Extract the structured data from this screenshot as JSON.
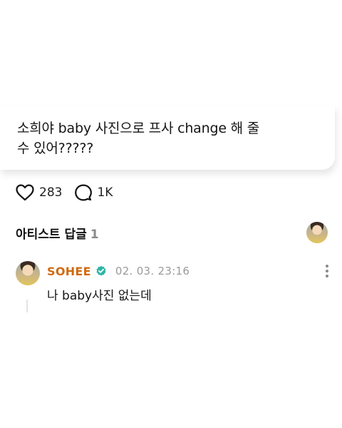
{
  "post": {
    "text_line1": "소희야 baby 사진으로 프사 change 해 줄",
    "text_line2": "수 있어?????"
  },
  "actions": {
    "like_icon": "heart-icon",
    "like_count": "283",
    "comment_icon": "comment-bubble-icon",
    "comment_count": "1K"
  },
  "artist_replies": {
    "title": "아티스트 답글",
    "count": "1"
  },
  "reply": {
    "author": "SOHEE",
    "author_color": "#d06a10",
    "verified_icon": "verified-badge-icon",
    "verified_color": "#2fb5a7",
    "timestamp": "02. 03. 23:16",
    "text": "나 baby사진 없는데",
    "more_icon": "more-vertical-icon"
  }
}
